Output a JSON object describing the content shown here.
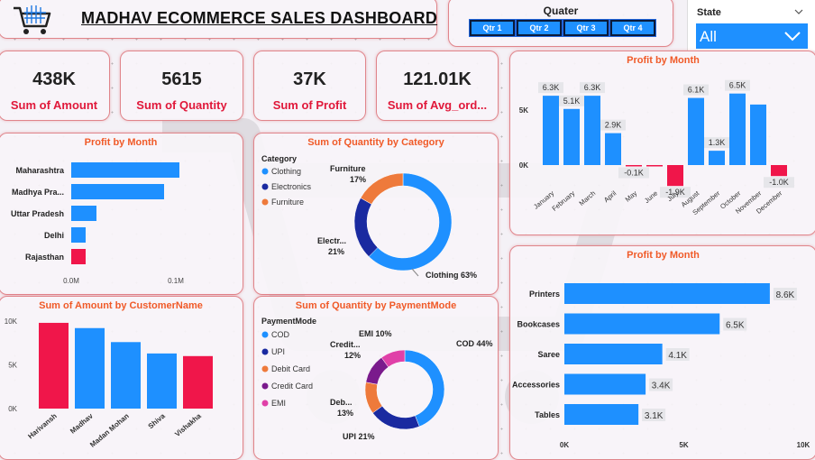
{
  "header": {
    "title": "MADHAV ECOMMERCE SALES DASHBOARD",
    "logo_icon": "shopping-cart-icon"
  },
  "quarter_slicer": {
    "label": "Quater",
    "options": [
      "Qtr 1",
      "Qtr 2",
      "Qtr 3",
      "Qtr 4"
    ]
  },
  "state_slicer": {
    "label": "State",
    "value": "All"
  },
  "kpis": [
    {
      "value": "438K",
      "label": "Sum of Amount"
    },
    {
      "value": "5615",
      "label": "Sum of Quantity"
    },
    {
      "value": "37K",
      "label": "Sum of Profit"
    },
    {
      "value": "121.01K",
      "label": "Sum of Avg_ord..."
    }
  ],
  "colors": {
    "blue": "#1e90ff",
    "red": "#f0164a",
    "orange": "#ee7a3b",
    "navy": "#1a2aa0",
    "purple": "#7a1a8c",
    "pink": "#e040a8",
    "title_orange": "#f05a28"
  },
  "chart_data": [
    {
      "type": "bar",
      "orientation": "horizontal",
      "title": "Profit by Month",
      "categories": [
        "Maharashtra",
        "Madhya Pra...",
        "Uttar Pradesh",
        "Delhi",
        "Rajasthan"
      ],
      "values": [
        0.12,
        0.103,
        0.028,
        0.016,
        0.016
      ],
      "highlight": [
        false,
        false,
        false,
        false,
        true
      ],
      "xlim": [
        0,
        0.12
      ],
      "xticks": [
        "0.0M",
        "0.1M"
      ]
    },
    {
      "type": "pie",
      "donut": true,
      "title": "Sum of Quantity by Category",
      "legend_title": "Category",
      "labels": [
        "Clothing",
        "Electronics",
        "Furniture"
      ],
      "values": [
        63,
        21,
        17
      ],
      "slice_labels": [
        "Clothing 63%",
        "Electr... 21%",
        "Furniture 17%"
      ]
    },
    {
      "type": "bar",
      "title": "Profit by Month",
      "categories": [
        "January",
        "February",
        "March",
        "April",
        "May",
        "June",
        "July",
        "August",
        "September",
        "October",
        "November",
        "December"
      ],
      "values": [
        6.3,
        5.1,
        6.3,
        2.9,
        -0.1,
        -0.1,
        -1.9,
        6.1,
        1.3,
        6.5,
        5.5,
        -1.0
      ],
      "data_labels": [
        "6.3K",
        "5.1K",
        "6.3K",
        "2.9K",
        "-0.1K",
        "",
        "-1.9K",
        "6.1K",
        "1.3K",
        "6.5K",
        "",
        "-1.0K"
      ],
      "yticks": [
        "5K",
        "0K"
      ],
      "ylim": [
        -2.5,
        7.5
      ]
    },
    {
      "type": "bar",
      "title": "Sum of Amount by CustomerName",
      "categories": [
        "Harivansh",
        "Madhav",
        "Madan Mohan",
        "Shiva",
        "Vishakha"
      ],
      "values": [
        9.8,
        9.2,
        7.6,
        6.3,
        6.0
      ],
      "highlight": [
        true,
        false,
        false,
        false,
        true
      ],
      "yticks": [
        "10K",
        "5K",
        "0K"
      ],
      "ylim": [
        0,
        10
      ]
    },
    {
      "type": "pie",
      "donut": true,
      "title": "Sum of Quantity by PaymentMode",
      "legend_title": "PaymentMode",
      "labels": [
        "COD",
        "UPI",
        "Debit Card",
        "Credit Card",
        "EMI"
      ],
      "values": [
        44,
        21,
        13,
        12,
        10
      ],
      "slice_labels": [
        "COD 44%",
        "UPI 21%",
        "Deb... 13%",
        "Credit... 12%",
        "EMI 10%"
      ]
    },
    {
      "type": "bar",
      "orientation": "horizontal",
      "title": "Profit by Month",
      "categories": [
        "Printers",
        "Bookcases",
        "Saree",
        "Accessories",
        "Tables"
      ],
      "values": [
        8.6,
        6.5,
        4.1,
        3.4,
        3.1
      ],
      "data_labels": [
        "8.6K",
        "6.5K",
        "4.1K",
        "3.4K",
        "3.1K"
      ],
      "xticks": [
        "0K",
        "5K",
        "10K"
      ],
      "xlim": [
        0,
        10
      ]
    }
  ]
}
